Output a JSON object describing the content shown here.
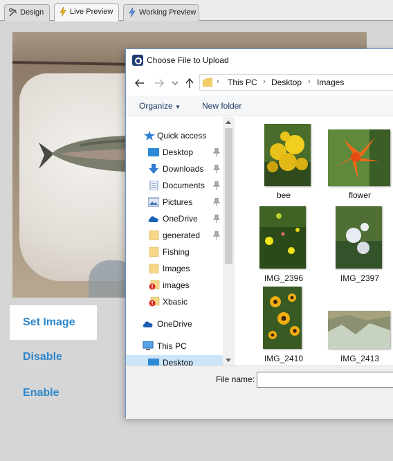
{
  "tabs": [
    {
      "label": "Design",
      "icon": "design-icon"
    },
    {
      "label": "Live Preview",
      "icon": "lightning-icon"
    },
    {
      "label": "Working Preview",
      "icon": "lightning-blue-icon"
    }
  ],
  "buttons": {
    "set_image": "Set Image",
    "disable": "Disable",
    "enable": "Enable"
  },
  "dialog": {
    "title": "Choose File to Upload",
    "breadcrumb": [
      "This PC",
      "Desktop",
      "Images"
    ],
    "organize": "Organize",
    "new_folder": "New folder",
    "nav_items": [
      {
        "label": "Quick access",
        "icon": "star-icon",
        "pinned": false
      },
      {
        "label": "Desktop",
        "icon": "desktop-icon",
        "pinned": true
      },
      {
        "label": "Downloads",
        "icon": "download-icon",
        "pinned": true
      },
      {
        "label": "Documents",
        "icon": "documents-icon",
        "pinned": true
      },
      {
        "label": "Pictures",
        "icon": "pictures-icon",
        "pinned": true
      },
      {
        "label": "OneDrive",
        "icon": "cloud-icon",
        "pinned": true
      },
      {
        "label": "generated",
        "icon": "folder-icon",
        "pinned": true
      },
      {
        "label": "Fishing",
        "icon": "folder-icon",
        "pinned": false
      },
      {
        "label": "Images",
        "icon": "folder-icon",
        "pinned": false
      },
      {
        "label": "images",
        "icon": "folder-error-icon",
        "pinned": false
      },
      {
        "label": "Xbasic",
        "icon": "folder-error-icon",
        "pinned": false
      },
      {
        "label": "OneDrive",
        "icon": "cloud-icon",
        "pinned": false
      },
      {
        "label": "This PC",
        "icon": "computer-icon",
        "pinned": false
      },
      {
        "label": "Desktop",
        "icon": "desktop-icon",
        "pinned": false
      }
    ],
    "files": [
      {
        "name": "bee"
      },
      {
        "name": "flower"
      },
      {
        "name": "IMG_2396"
      },
      {
        "name": "IMG_2397"
      },
      {
        "name": "IMG_2410"
      },
      {
        "name": "IMG_2413"
      }
    ],
    "file_name_label": "File name:",
    "file_name_value": ""
  },
  "colors": {
    "button_text": "#2c86c9",
    "dialog_border": "#6a8fc7",
    "selected_nav": "#cce4f7"
  }
}
